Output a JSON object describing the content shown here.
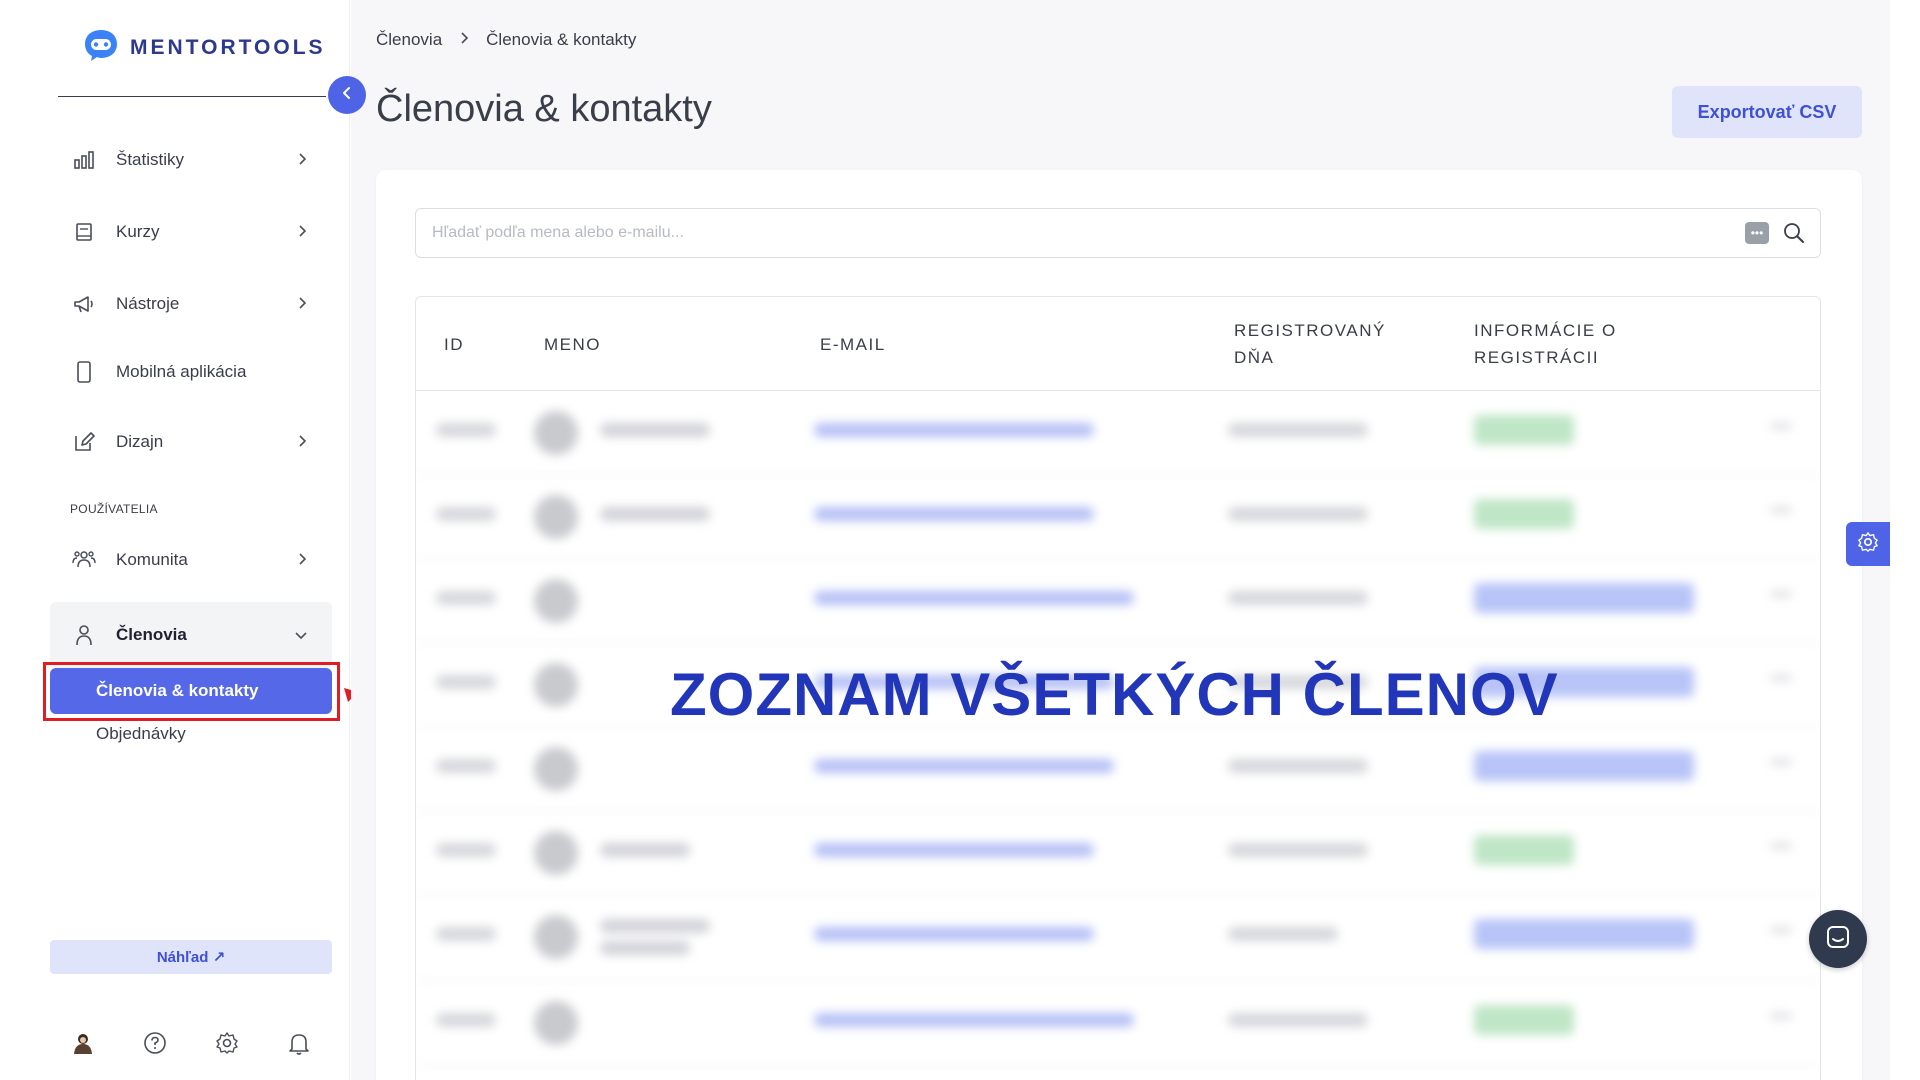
{
  "brand": {
    "name": "MENTORTOOLS"
  },
  "sidebar": {
    "items": [
      {
        "label": "Štatistiky"
      },
      {
        "label": "Kurzy"
      },
      {
        "label": "Nástroje"
      },
      {
        "label": "Mobilná aplikácia"
      },
      {
        "label": "Dizajn"
      },
      {
        "label": "Komunita"
      },
      {
        "label": "Členovia"
      }
    ],
    "section_label": "POUŽÍVATELIA",
    "sub_items": [
      {
        "label": "Členovia & kontakty"
      },
      {
        "label": "Objednávky"
      }
    ],
    "preview_label": "Náhľad ↗"
  },
  "breadcrumb": {
    "root": "Členovia",
    "current": "Členovia & kontakty"
  },
  "page": {
    "title": "Členovia & kontakty",
    "export_label": "Exportovať CSV"
  },
  "search": {
    "placeholder": "Hľadať podľa mena alebo e-mailu..."
  },
  "table": {
    "columns": [
      "ID",
      "MENO",
      "E-MAIL",
      "REGISTROVANÝ DŇA",
      "INFORMÁCIE O REGISTRÁCII"
    ]
  },
  "overlay": {
    "text": "ZOZNAM VŠETKÝCH ČLENOV"
  },
  "colors": {
    "accent": "#4f63e7",
    "highlight": "#e11d24",
    "overlay_text": "#2136b8"
  }
}
